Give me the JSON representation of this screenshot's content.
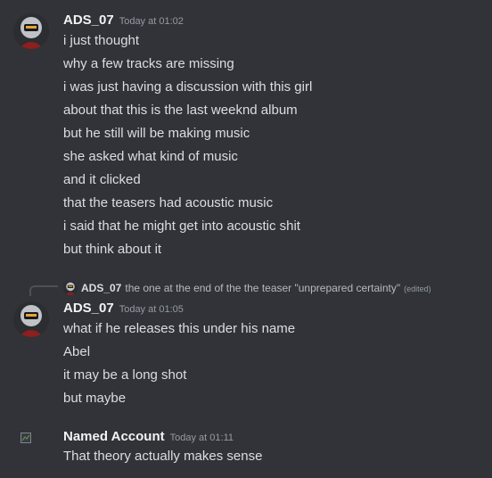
{
  "messages": [
    {
      "author": "ADS_07",
      "timestamp": "Today at 01:02",
      "lines": [
        "i just thought",
        "why a few tracks are missing",
        "i was just having a discussion with this girl",
        "about that this is the last weeknd album",
        "but he still will be making music",
        "she asked what kind of music",
        "and it clicked",
        "that the teasers had acoustic music",
        "i said that he might get into acoustic shit",
        "but think about it"
      ]
    },
    {
      "reply": {
        "author": "ADS_07",
        "text": "the one at the end of the the teaser \"unprepared certainty\"",
        "edited": "(edited)"
      },
      "author": "ADS_07",
      "timestamp": "Today at 01:05",
      "lines": [
        "what if he releases this under his name",
        "Abel",
        "it may be a long shot",
        "but maybe"
      ]
    },
    {
      "author": "Named Account",
      "timestamp": "Today at 01:11",
      "lines": [
        "That theory actually makes sense"
      ]
    }
  ],
  "colors": {
    "background": "#313338",
    "username": "#f2f3f5",
    "text": "#dbdee1",
    "timestamp": "#949ba4"
  }
}
